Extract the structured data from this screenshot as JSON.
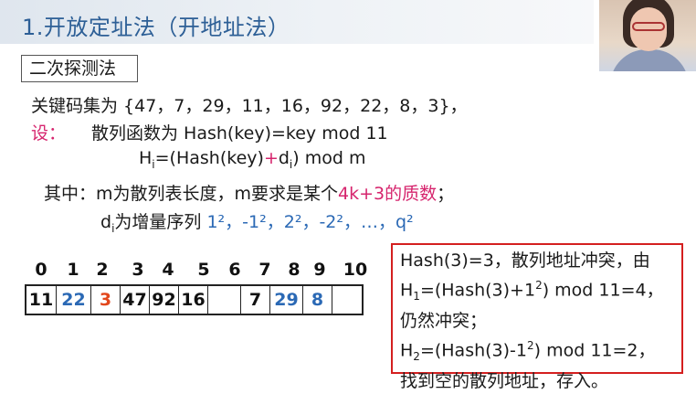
{
  "section_title": "1.开放定址法（开地址法）",
  "method_label": "二次探测法",
  "keyset_line": "关键码集为 {47，7，29，11，16，92，22，8，3}，",
  "let_label": "设：",
  "hash_func_line": "散列函数为 Hash(key)=key mod 11",
  "hi_formula": {
    "prefix": "H",
    "sub_i": "i",
    "mid": "=(Hash(key)",
    "plus": "+",
    "d": "d",
    "sub_i2": "i",
    "suffix": ") mod m"
  },
  "where_line": {
    "text": "其中：m为散列表长度，m要求是某个",
    "highlight": "4k+3的质数",
    "end": "；"
  },
  "di_line": {
    "d": "d",
    "sub_i": "i",
    "text": "为增量序列",
    "seq": "1²，-1²，2²，-2²，…，q²"
  },
  "table": {
    "indices": [
      "0",
      "1",
      "2",
      "3",
      "4",
      "5",
      "6",
      "7",
      "8",
      "9",
      "10"
    ],
    "cells": [
      {
        "value": "11",
        "color": "#111111"
      },
      {
        "value": "22",
        "color": "#2b69b5"
      },
      {
        "value": "3",
        "color": "#e2471c"
      },
      {
        "value": "47",
        "color": "#111111"
      },
      {
        "value": "92",
        "color": "#111111"
      },
      {
        "value": "16",
        "color": "#111111"
      },
      {
        "value": "",
        "color": "#111111"
      },
      {
        "value": "7",
        "color": "#111111"
      },
      {
        "value": "29",
        "color": "#2b69b5"
      },
      {
        "value": "8",
        "color": "#2b69b5"
      },
      {
        "value": "",
        "color": "#111111"
      }
    ]
  },
  "note": {
    "line1": "Hash(3)=3，散列地址冲突，由",
    "line2_prefix": "H",
    "line2_sub": "1",
    "line2_text": "=(Hash(3)+1",
    "line2_sup": "2",
    "line2_end": ") mod 11=4，",
    "line3": "仍然冲突；",
    "line4_prefix": "H",
    "line4_sub": "2",
    "line4_text": "=(Hash(3)-1",
    "line4_sup": "2",
    "line4_end": ") mod 11=2，",
    "line5": "找到空的散列地址，存入。"
  },
  "colors": {
    "title": "#2d5f96",
    "pink": "#d6246d",
    "blue": "#2b69b5",
    "note_border": "#d41f1f"
  }
}
